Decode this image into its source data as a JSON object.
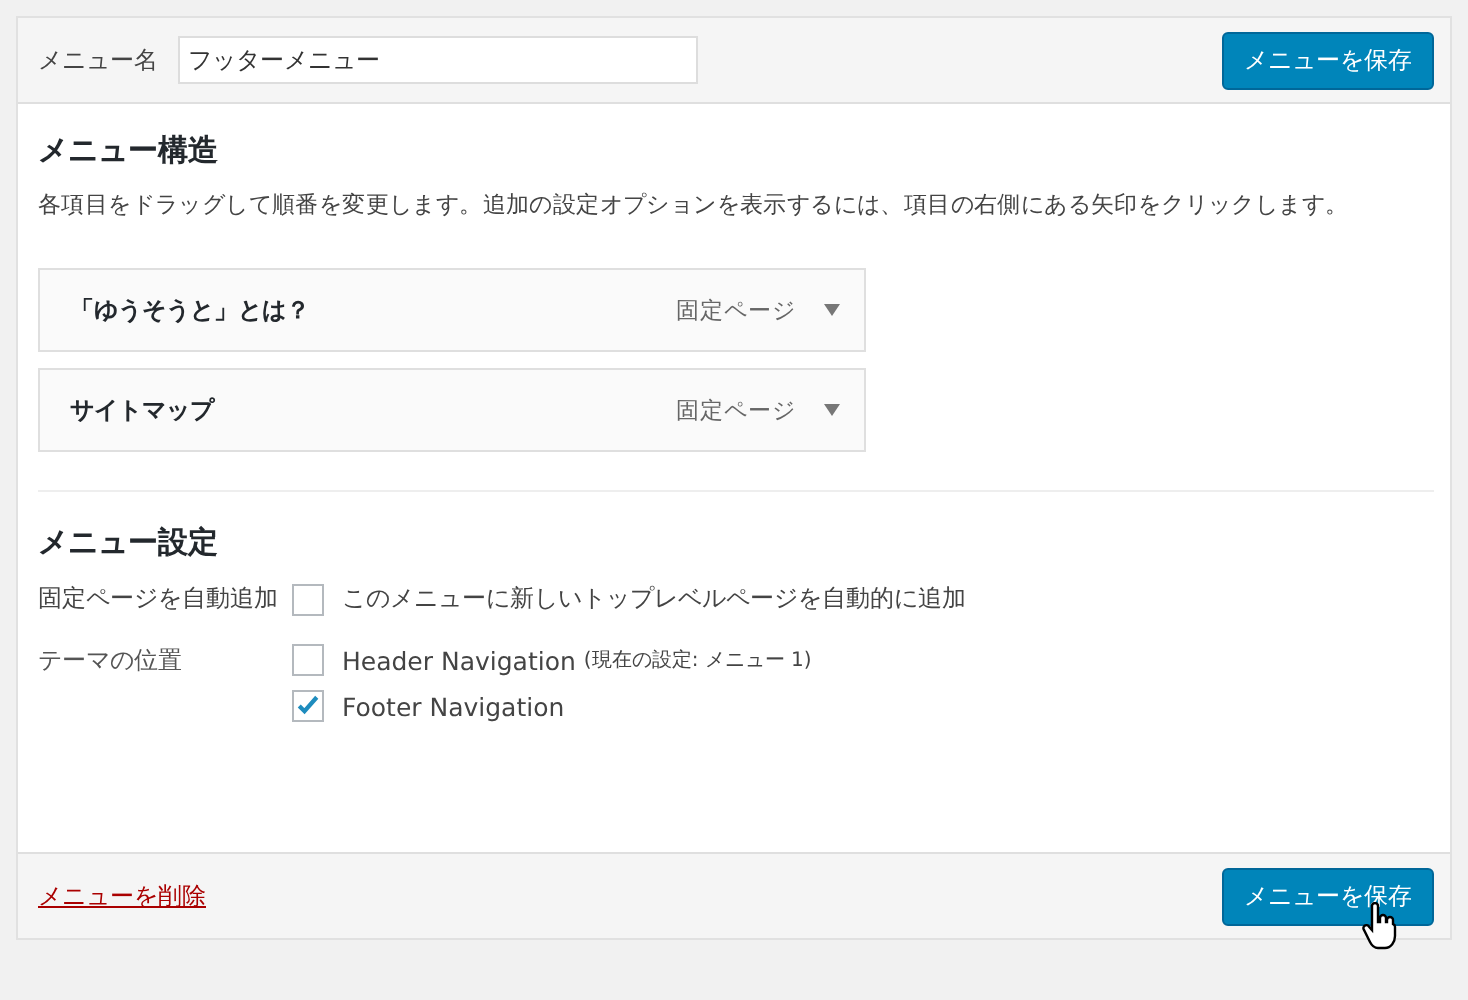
{
  "header": {
    "name_label": "メニュー名",
    "name_value": "フッターメニュー",
    "save_button": "メニューを保存"
  },
  "structure": {
    "title": "メニュー構造",
    "description": "各項目をドラッグして順番を変更します。追加の設定オプションを表示するには、項目の右側にある矢印をクリックします。",
    "items": [
      {
        "title": "「ゆうそうと」とは？",
        "type": "固定ページ"
      },
      {
        "title": "サイトマップ",
        "type": "固定ページ"
      }
    ]
  },
  "settings": {
    "title": "メニュー設定",
    "auto_add": {
      "label": "固定ページを自動追加",
      "option": "このメニューに新しいトップレベルページを自動的に追加",
      "checked": false
    },
    "locations": {
      "label": "テーマの位置",
      "options": [
        {
          "name": "Header Navigation",
          "note": "(現在の設定: メニュー 1)",
          "checked": false
        },
        {
          "name": "Footer Navigation",
          "checked": true
        }
      ]
    }
  },
  "footer": {
    "delete_link": "メニューを削除",
    "save_button": "メニューを保存"
  }
}
